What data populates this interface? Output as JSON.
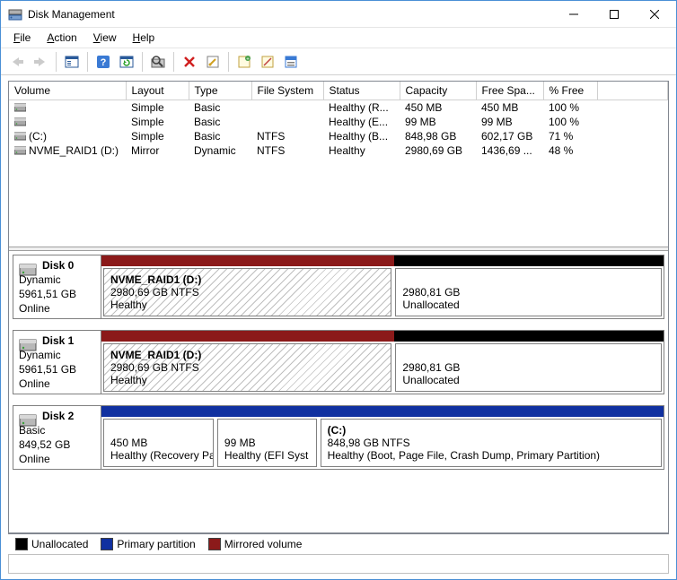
{
  "window": {
    "title": "Disk Management"
  },
  "menu": {
    "file": "File",
    "action": "Action",
    "view": "View",
    "help": "Help"
  },
  "columns": {
    "volume": "Volume",
    "layout": "Layout",
    "type": "Type",
    "fs": "File System",
    "status": "Status",
    "capacity": "Capacity",
    "free": "Free Spa...",
    "pct": "% Free"
  },
  "volumes": [
    {
      "name": "",
      "layout": "Simple",
      "type": "Basic",
      "fs": "",
      "status": "Healthy (R...",
      "cap": "450 MB",
      "free": "450 MB",
      "pct": "100 %"
    },
    {
      "name": "",
      "layout": "Simple",
      "type": "Basic",
      "fs": "",
      "status": "Healthy (E...",
      "cap": "99 MB",
      "free": "99 MB",
      "pct": "100 %"
    },
    {
      "name": "(C:)",
      "layout": "Simple",
      "type": "Basic",
      "fs": "NTFS",
      "status": "Healthy (B...",
      "cap": "848,98 GB",
      "free": "602,17 GB",
      "pct": "71 %"
    },
    {
      "name": "NVME_RAID1 (D:)",
      "layout": "Mirror",
      "type": "Dynamic",
      "fs": "NTFS",
      "status": "Healthy",
      "cap": "2980,69 GB",
      "free": "1436,69 ...",
      "pct": "48 %"
    }
  ],
  "disks": [
    {
      "label": "Disk 0",
      "type": "Dynamic",
      "size": "5961,51 GB",
      "state": "Online",
      "bars": [
        {
          "color": "c-mirror",
          "width": "52%"
        },
        {
          "color": "c-black",
          "width": "48%"
        }
      ],
      "parts": [
        {
          "title": "NVME_RAID1  (D:)",
          "sub": "2980,69 GB NTFS",
          "status": "Healthy",
          "hatched": true,
          "width": "52%"
        },
        {
          "title": "",
          "sub": "2980,81 GB",
          "status": "Unallocated",
          "hatched": false,
          "width": "48%"
        }
      ]
    },
    {
      "label": "Disk 1",
      "type": "Dynamic",
      "size": "5961,51 GB",
      "state": "Online",
      "bars": [
        {
          "color": "c-mirror",
          "width": "52%"
        },
        {
          "color": "c-black",
          "width": "48%"
        }
      ],
      "parts": [
        {
          "title": "NVME_RAID1  (D:)",
          "sub": "2980,69 GB NTFS",
          "status": "Healthy",
          "hatched": true,
          "width": "52%"
        },
        {
          "title": "",
          "sub": "2980,81 GB",
          "status": "Unallocated",
          "hatched": false,
          "width": "48%"
        }
      ]
    },
    {
      "label": "Disk 2",
      "type": "Basic",
      "size": "849,52 GB",
      "state": "Online",
      "bars": [
        {
          "color": "c-primary",
          "width": "18%"
        },
        {
          "color": "c-primary",
          "width": "18%"
        },
        {
          "color": "c-primary",
          "width": "64%"
        }
      ],
      "parts": [
        {
          "title": "",
          "sub": "450 MB",
          "status": "Healthy (Recovery Parti",
          "hatched": false,
          "width": "20%"
        },
        {
          "title": "",
          "sub": "99 MB",
          "status": "Healthy (EFI Syst",
          "hatched": false,
          "width": "18%"
        },
        {
          "title": "(C:)",
          "sub": "848,98 GB NTFS",
          "status": "Healthy (Boot, Page File, Crash Dump, Primary Partition)",
          "hatched": false,
          "width": "62%"
        }
      ]
    }
  ],
  "legend": {
    "unallocated": "Unallocated",
    "primary": "Primary partition",
    "mirror": "Mirrored volume"
  },
  "colors": {
    "mirror": "#8b1a1a",
    "primary": "#1030a0",
    "unallocated": "#000000"
  }
}
